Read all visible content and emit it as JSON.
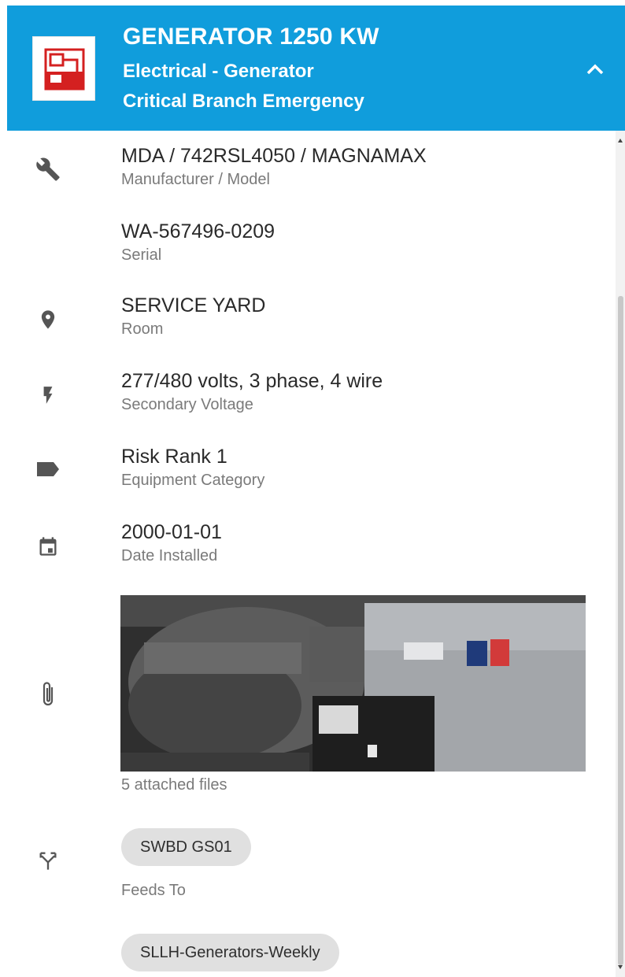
{
  "header": {
    "title": "GENERATOR 1250 KW",
    "subtitle_type": "Electrical - Generator",
    "subtitle_branch": "Critical Branch Emergency",
    "thumbnail_icon": "generator-symbol-icon",
    "collapse_icon": "chevron-up-icon",
    "color": "#109ddc"
  },
  "details": [
    {
      "icon": "wrench-icon",
      "value": "MDA / 742RSL4050 / MAGNAMAX",
      "label": "Manufacturer / Model"
    },
    {
      "icon": "",
      "value": "WA-567496-0209",
      "label": "Serial"
    },
    {
      "icon": "location-pin-icon",
      "value": "SERVICE YARD",
      "label": "Room"
    },
    {
      "icon": "lightning-bolt-icon",
      "value": "277/480 volts, 3 phase, 4 wire",
      "label": "Secondary Voltage"
    },
    {
      "icon": "tag-icon",
      "value": "Risk Rank 1",
      "label": "Equipment Category"
    },
    {
      "icon": "calendar-icon",
      "value": "2000-01-01",
      "label": "Date Installed"
    }
  ],
  "attachments": {
    "icon": "paperclip-icon",
    "label": "5 attached files"
  },
  "feeds": {
    "icon": "fork-arrows-icon",
    "chip": "SWBD GS01",
    "label": "Feeds To"
  },
  "schedule": {
    "chip": "SLLH-Generators-Weekly"
  }
}
